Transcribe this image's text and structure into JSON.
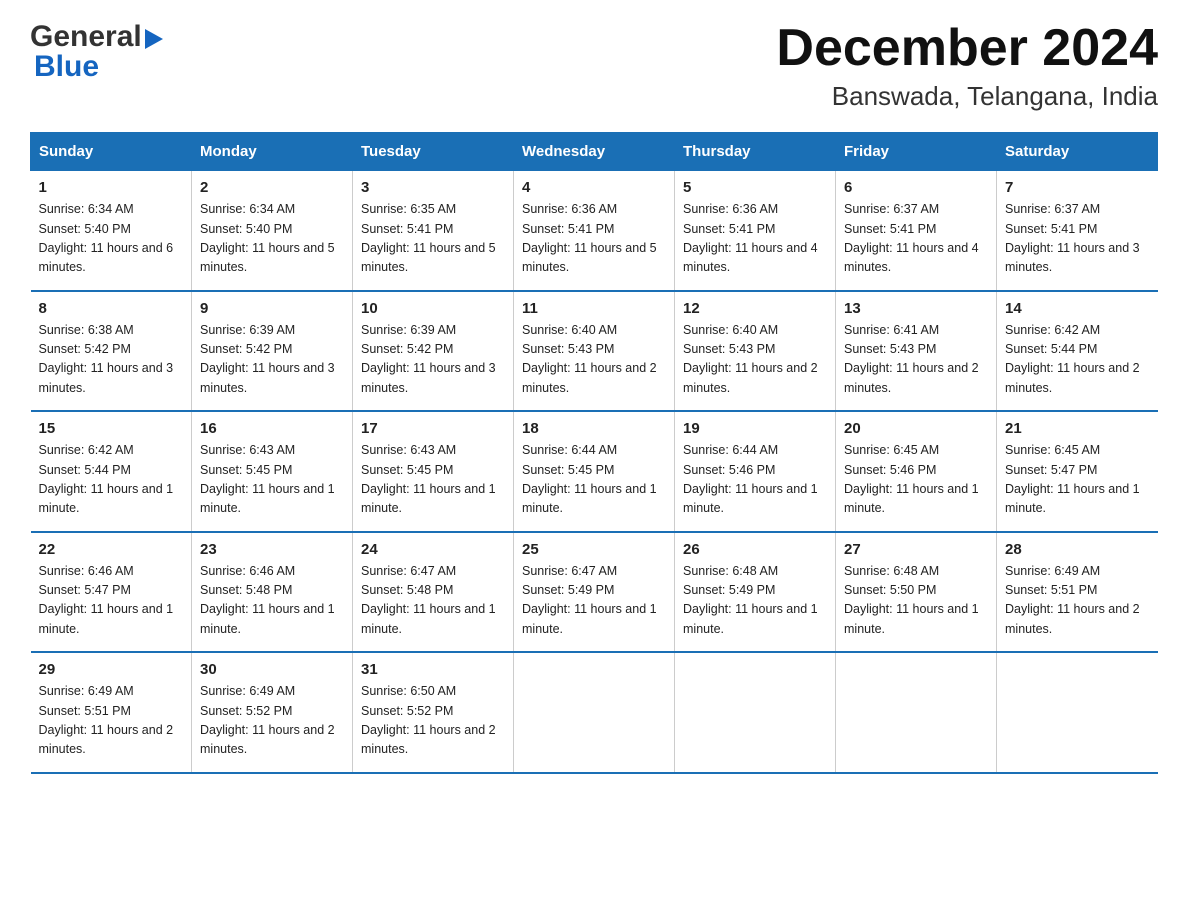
{
  "logo": {
    "text_general": "General",
    "text_blue": "Blue",
    "arrow": "▶"
  },
  "header": {
    "month_year": "December 2024",
    "location": "Banswada, Telangana, India"
  },
  "columns": [
    "Sunday",
    "Monday",
    "Tuesday",
    "Wednesday",
    "Thursday",
    "Friday",
    "Saturday"
  ],
  "weeks": [
    [
      {
        "day": "1",
        "sunrise": "6:34 AM",
        "sunset": "5:40 PM",
        "daylight": "11 hours and 6 minutes."
      },
      {
        "day": "2",
        "sunrise": "6:34 AM",
        "sunset": "5:40 PM",
        "daylight": "11 hours and 5 minutes."
      },
      {
        "day": "3",
        "sunrise": "6:35 AM",
        "sunset": "5:41 PM",
        "daylight": "11 hours and 5 minutes."
      },
      {
        "day": "4",
        "sunrise": "6:36 AM",
        "sunset": "5:41 PM",
        "daylight": "11 hours and 5 minutes."
      },
      {
        "day": "5",
        "sunrise": "6:36 AM",
        "sunset": "5:41 PM",
        "daylight": "11 hours and 4 minutes."
      },
      {
        "day": "6",
        "sunrise": "6:37 AM",
        "sunset": "5:41 PM",
        "daylight": "11 hours and 4 minutes."
      },
      {
        "day": "7",
        "sunrise": "6:37 AM",
        "sunset": "5:41 PM",
        "daylight": "11 hours and 3 minutes."
      }
    ],
    [
      {
        "day": "8",
        "sunrise": "6:38 AM",
        "sunset": "5:42 PM",
        "daylight": "11 hours and 3 minutes."
      },
      {
        "day": "9",
        "sunrise": "6:39 AM",
        "sunset": "5:42 PM",
        "daylight": "11 hours and 3 minutes."
      },
      {
        "day": "10",
        "sunrise": "6:39 AM",
        "sunset": "5:42 PM",
        "daylight": "11 hours and 3 minutes."
      },
      {
        "day": "11",
        "sunrise": "6:40 AM",
        "sunset": "5:43 PM",
        "daylight": "11 hours and 2 minutes."
      },
      {
        "day": "12",
        "sunrise": "6:40 AM",
        "sunset": "5:43 PM",
        "daylight": "11 hours and 2 minutes."
      },
      {
        "day": "13",
        "sunrise": "6:41 AM",
        "sunset": "5:43 PM",
        "daylight": "11 hours and 2 minutes."
      },
      {
        "day": "14",
        "sunrise": "6:42 AM",
        "sunset": "5:44 PM",
        "daylight": "11 hours and 2 minutes."
      }
    ],
    [
      {
        "day": "15",
        "sunrise": "6:42 AM",
        "sunset": "5:44 PM",
        "daylight": "11 hours and 1 minute."
      },
      {
        "day": "16",
        "sunrise": "6:43 AM",
        "sunset": "5:45 PM",
        "daylight": "11 hours and 1 minute."
      },
      {
        "day": "17",
        "sunrise": "6:43 AM",
        "sunset": "5:45 PM",
        "daylight": "11 hours and 1 minute."
      },
      {
        "day": "18",
        "sunrise": "6:44 AM",
        "sunset": "5:45 PM",
        "daylight": "11 hours and 1 minute."
      },
      {
        "day": "19",
        "sunrise": "6:44 AM",
        "sunset": "5:46 PM",
        "daylight": "11 hours and 1 minute."
      },
      {
        "day": "20",
        "sunrise": "6:45 AM",
        "sunset": "5:46 PM",
        "daylight": "11 hours and 1 minute."
      },
      {
        "day": "21",
        "sunrise": "6:45 AM",
        "sunset": "5:47 PM",
        "daylight": "11 hours and 1 minute."
      }
    ],
    [
      {
        "day": "22",
        "sunrise": "6:46 AM",
        "sunset": "5:47 PM",
        "daylight": "11 hours and 1 minute."
      },
      {
        "day": "23",
        "sunrise": "6:46 AM",
        "sunset": "5:48 PM",
        "daylight": "11 hours and 1 minute."
      },
      {
        "day": "24",
        "sunrise": "6:47 AM",
        "sunset": "5:48 PM",
        "daylight": "11 hours and 1 minute."
      },
      {
        "day": "25",
        "sunrise": "6:47 AM",
        "sunset": "5:49 PM",
        "daylight": "11 hours and 1 minute."
      },
      {
        "day": "26",
        "sunrise": "6:48 AM",
        "sunset": "5:49 PM",
        "daylight": "11 hours and 1 minute."
      },
      {
        "day": "27",
        "sunrise": "6:48 AM",
        "sunset": "5:50 PM",
        "daylight": "11 hours and 1 minute."
      },
      {
        "day": "28",
        "sunrise": "6:49 AM",
        "sunset": "5:51 PM",
        "daylight": "11 hours and 2 minutes."
      }
    ],
    [
      {
        "day": "29",
        "sunrise": "6:49 AM",
        "sunset": "5:51 PM",
        "daylight": "11 hours and 2 minutes."
      },
      {
        "day": "30",
        "sunrise": "6:49 AM",
        "sunset": "5:52 PM",
        "daylight": "11 hours and 2 minutes."
      },
      {
        "day": "31",
        "sunrise": "6:50 AM",
        "sunset": "5:52 PM",
        "daylight": "11 hours and 2 minutes."
      },
      null,
      null,
      null,
      null
    ]
  ]
}
